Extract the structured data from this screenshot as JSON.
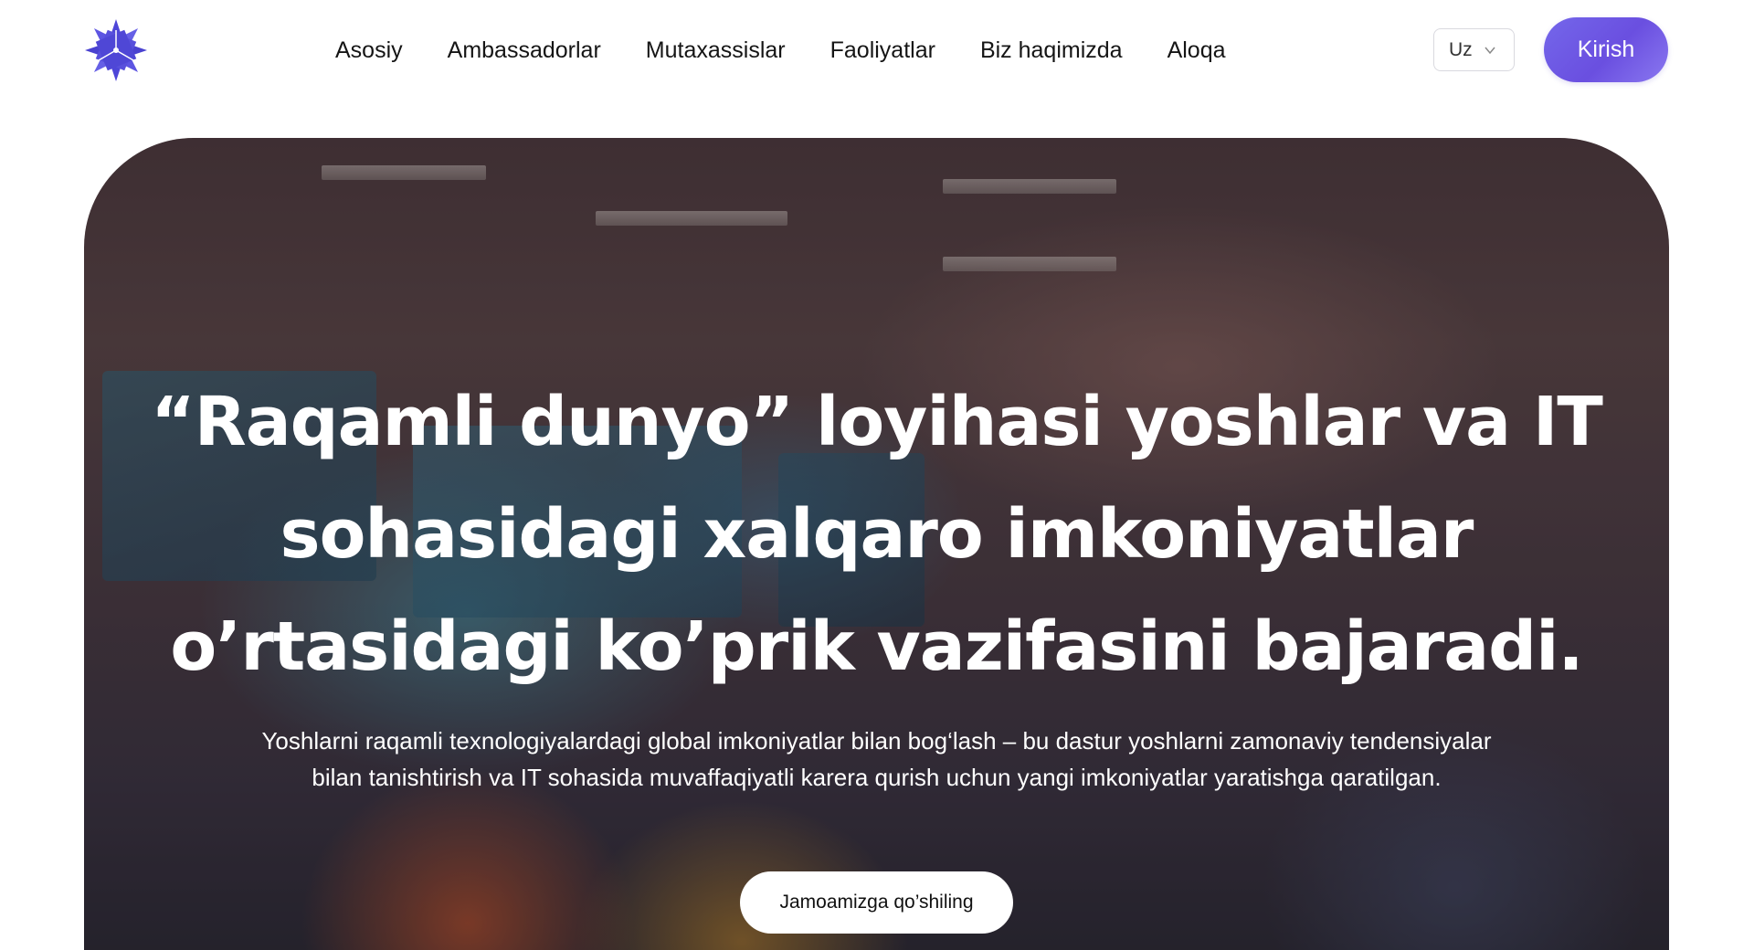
{
  "brand": {
    "logo_icon": "star-crystal-logo-icon",
    "accent": "#5b50e0"
  },
  "nav": {
    "items": [
      {
        "label": "Asosiy"
      },
      {
        "label": "Ambassadorlar"
      },
      {
        "label": "Mutaxassislar"
      },
      {
        "label": "Faoliyatlar"
      },
      {
        "label": "Biz haqimizda"
      },
      {
        "label": "Aloqa"
      }
    ]
  },
  "language": {
    "selected": "Uz",
    "icon": "chevron-down-icon"
  },
  "login": {
    "label": "Kirish",
    "color": "#6e5ae6"
  },
  "hero": {
    "title": "“Raqamli dunyo” loyihasi yoshlar va IT sohasidagi xalqaro imkoniyatlar o’rtasidagi ko’prik vazifasini bajaradi.",
    "subtitle": "Yoshlarni raqamli texnologiyalardagi global imkoniyatlar bilan bog‘lash – bu dastur yoshlarni zamonaviy tendensiyalar bilan tanishtirish va IT sohasida muvaffaqiyatli karera qurish uchun yangi imkoniyatlar yaratishga qaratilgan.",
    "cta_label": "Jamoamizga qo’shiling"
  }
}
